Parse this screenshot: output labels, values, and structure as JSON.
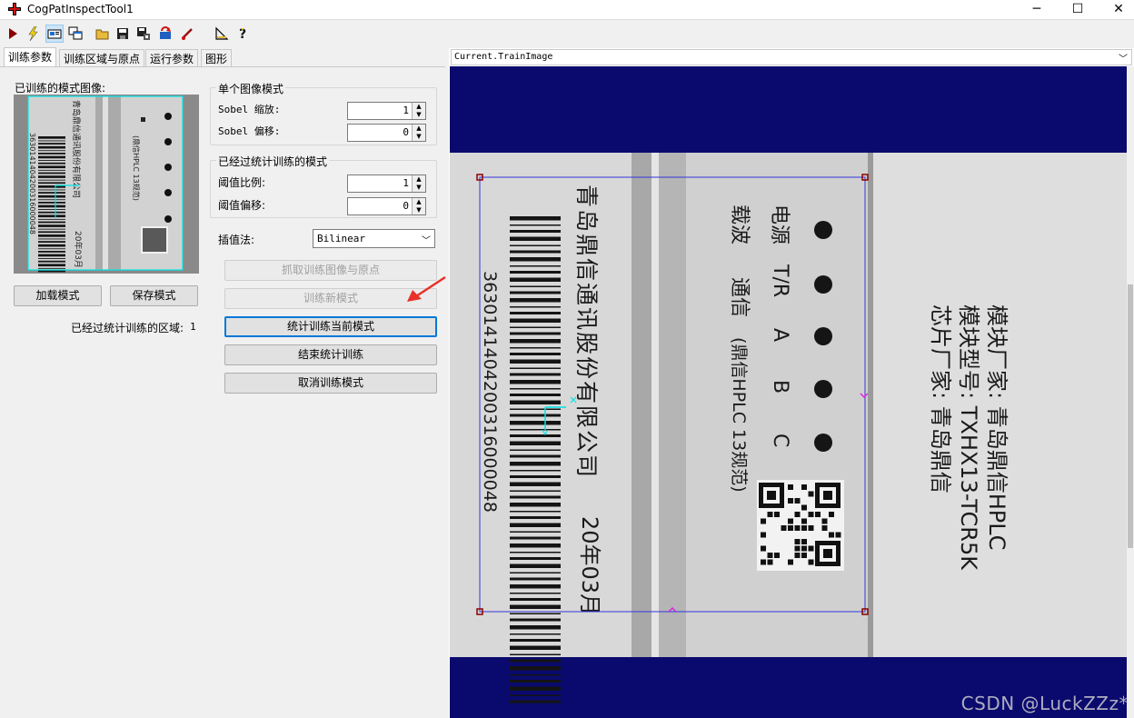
{
  "window": {
    "title": "CogPatInspectTool1",
    "minimize": "─",
    "maximize": "☐",
    "close": "✕"
  },
  "toolbar": {
    "buttons": [
      {
        "icon": "run-icon"
      },
      {
        "icon": "electric-icon"
      },
      {
        "icon": "show-display-icon"
      },
      {
        "icon": "floating-window-icon"
      },
      {
        "icon": "open-folder-icon"
      },
      {
        "icon": "save-icon"
      },
      {
        "icon": "save-settings-icon"
      },
      {
        "icon": "reset-icon"
      },
      {
        "icon": "local-graphics-icon"
      },
      {
        "icon": "edit-icon"
      },
      {
        "icon": "help-icon"
      }
    ]
  },
  "tabs": [
    {
      "label": "训练参数",
      "active": true
    },
    {
      "label": "训练区域与原点",
      "active": false
    },
    {
      "label": "运行参数",
      "active": false
    },
    {
      "label": "图形",
      "active": false
    }
  ],
  "left": {
    "trained_image_label": "已训练的模式图像:",
    "load_button": "加载模式",
    "save_button": "保存模式",
    "stat_regions_label": "已经过统计训练的区域:",
    "stat_regions_value": "1"
  },
  "single_image": {
    "title": "单个图像模式",
    "sobel_scale_label": "Sobel 缩放:",
    "sobel_scale_value": "1",
    "sobel_offset_label": "Sobel 偏移:",
    "sobel_offset_value": "0"
  },
  "stat_trained": {
    "title": "已经过统计训练的模式",
    "threshold_scale_label": "阈值比例:",
    "threshold_scale_value": "1",
    "threshold_offset_label": "阈值偏移:",
    "threshold_offset_value": "0"
  },
  "interpolation": {
    "label": "插值法:",
    "value": "Bilinear"
  },
  "actions": {
    "grab_train_image": "抓取训练图像与原点",
    "train_new_pattern": "训练新模式",
    "stat_train_current": "统计训练当前模式",
    "end_stat_train": "结束统计训练",
    "cancel_train_mode": "取消训练模式"
  },
  "viewer": {
    "selected_image": "Current.TrainImage"
  },
  "label_text": {
    "company_full": "青岛鼎信通讯股份有限公司",
    "power": "电源",
    "tr": "T/R",
    "a": "A",
    "b": "B",
    "c": "C",
    "carrier": "载波",
    "comm": "通信",
    "spec": "(鼎信HPLC 13规范)",
    "serial": "3630141404200316000048",
    "date": "20年03月",
    "module_maker": "模块厂家: 青岛鼎信HPLC",
    "module_model": "模块型号: TXHX13-TCR5K",
    "chip_maker": "芯片厂家: 青岛鼎信"
  },
  "watermark": "CSDN @LuckZZz*",
  "colors": {
    "canvas_bg": "#0a0a6e",
    "roi": "#3333dd",
    "origin": "#00e5e5",
    "arrow": "#e8302a",
    "focus": "#0078d7"
  }
}
